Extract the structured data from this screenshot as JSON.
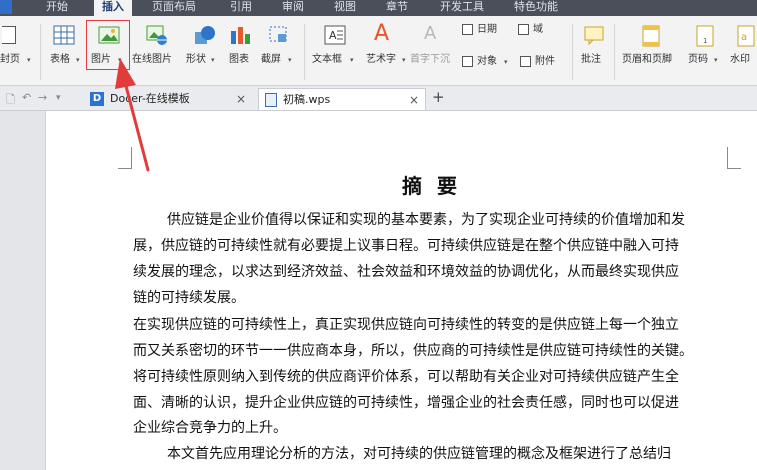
{
  "menu": {
    "tabs": [
      "开始",
      "插入",
      "页面布局",
      "引用",
      "审阅",
      "视图",
      "章节",
      "开发工具",
      "特色功能"
    ],
    "active": "插入"
  },
  "ribbon": {
    "cover_page": "封页",
    "table": "表格",
    "picture": "图片",
    "online_picture": "在线图片",
    "shape": "形状",
    "chart": "图表",
    "screenshot": "截屏",
    "textbox": "文本框",
    "wordart": "艺术字",
    "dropcap": "首字下沉",
    "date": "日期",
    "field": "域",
    "object": "对象",
    "attachment": "附件",
    "comment": "批注",
    "header_footer": "页眉和页脚",
    "page_number": "页码",
    "watermark": "水印"
  },
  "tabs": {
    "tab1_label": "Docer-在线模板",
    "tab2_label": "初稿.wps",
    "close_glyph": "×",
    "add_glyph": "+"
  },
  "document": {
    "title": "摘 要",
    "lines": [
      "供应链是企业价值得以保证和实现的基本要素，为了实现企业可持续的价值增加和发",
      "展，供应链的可持续性就有必要提上议事日程。可持续供应链是在整个供应链中融入可持",
      "续发展的理念，以求达到经济效益、社会效益和环境效益的协调优化，从而最终实现供应",
      "链的可持续发展。",
      "在实现供应链的可持续性上，真正实现供应链向可持续性的转变的是供应链上每一个独立",
      "而又关系密切的环节一一供应商本身，所以，供应商的可持续性是供应链可持续性的关键。",
      "将可持续性原则纳入到传统的供应商评价体系，可以帮助有关企业对可持续供应链产生全",
      "面、清晰的认识，提升企业供应链的可持续性，增强企业的社会责任感，同时也可以促进",
      "企业综合竞争力的上升。",
      "本文首先应用理论分析的方法，对可持续的供应链管理的概念及框架进行了总结归"
    ]
  },
  "colors": {
    "annotation": "#e23b3b",
    "menubar": "#4a4f5a",
    "ribbon": "#f3f3f3"
  }
}
